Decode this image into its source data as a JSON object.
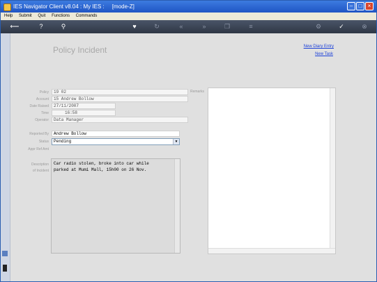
{
  "window": {
    "title": "IES Navigator Client v8.04 : My IES :     [mode-Z]"
  },
  "menu": [
    "Help",
    "Submit",
    "Quit",
    "Functions",
    "Commands"
  ],
  "toolbar_icons": [
    "back-arrow-icon",
    "help-icon",
    "search-icon",
    "heart-icon",
    "refresh-icon",
    "rewind-icon",
    "fast-forward-icon",
    "copy-icon",
    "list-icon",
    "gear-icon",
    "check-icon",
    "close-icon"
  ],
  "page": {
    "title": "Policy Incident"
  },
  "links": {
    "new_diary": "New Diary Entry",
    "new_task": "New Task"
  },
  "labels": {
    "policy": "Policy",
    "account": "Account",
    "date_raised": "Date Raised",
    "time": "Time",
    "operator": "Operator",
    "reported_by": "Reported By",
    "status": "Status",
    "appr_ref_amt": "Appr Ref Amt",
    "description": "Description",
    "of_incident": "of Incident",
    "remarks": "Remarks"
  },
  "fields": {
    "policy": "19 02",
    "account": "15 Andrew Bollow",
    "date_raised": "27/11/2007",
    "time": "16:58",
    "operator": "Data Manager",
    "reported_by": "Andrew Bollow",
    "status": "Pending",
    "appr_ref_amt": "",
    "description_line1": "Car radio stolen, broke into car while",
    "description_line2": "parked at Mumi Mall, 15h00 on 26 Nov.",
    "remarks": ""
  }
}
